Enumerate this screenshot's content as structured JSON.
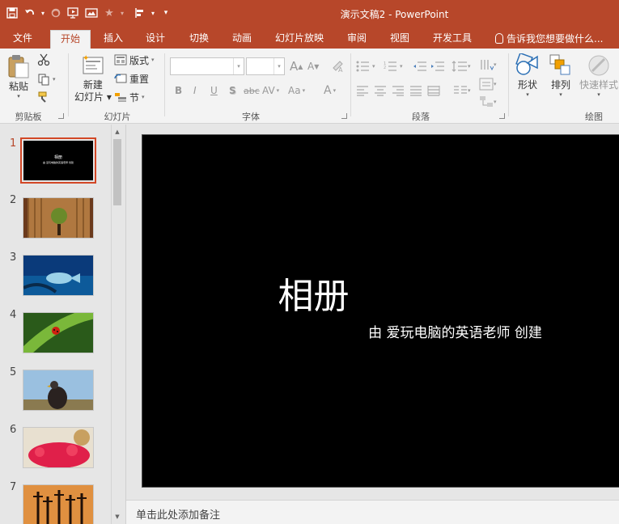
{
  "window": {
    "title": "演示文稿2 - PowerPoint"
  },
  "qat": {
    "save_icon": "save-icon",
    "undo_icon": "undo-icon",
    "redo_icon": "redo-icon",
    "present_icon": "from-beginning-icon",
    "caret": "▾"
  },
  "tabs": [
    {
      "label": "文件"
    },
    {
      "label": "开始"
    },
    {
      "label": "插入"
    },
    {
      "label": "设计"
    },
    {
      "label": "切换"
    },
    {
      "label": "动画"
    },
    {
      "label": "幻灯片放映"
    },
    {
      "label": "审阅"
    },
    {
      "label": "视图"
    },
    {
      "label": "开发工具"
    }
  ],
  "tell_me": "告诉我您想要做什么...",
  "ribbon": {
    "clipboard": {
      "paste": "粘贴",
      "label": "剪贴板"
    },
    "slides": {
      "new_slide_line1": "新建",
      "new_slide_line2": "幻灯片",
      "layout": "版式",
      "reset": "重置",
      "section": "节",
      "label": "幻灯片"
    },
    "font": {
      "label": "字体",
      "grow": "A",
      "shrink": "A",
      "bold": "B",
      "italic": "I",
      "underline": "U",
      "shadow": "S",
      "strike": "abc",
      "spacing": "AV",
      "case": "Aa",
      "color": "A"
    },
    "paragraph": {
      "label": "段落"
    },
    "drawing": {
      "shapes": "形状",
      "arrange": "排列",
      "quick_styles": "快速样式",
      "label": "绘图"
    }
  },
  "thumbnails": [
    {
      "num": "1",
      "selected": true,
      "title": "相册",
      "sub": "由 爱玩电脑的英语老师 创建"
    },
    {
      "num": "2",
      "selected": false
    },
    {
      "num": "3",
      "selected": false
    },
    {
      "num": "4",
      "selected": false
    },
    {
      "num": "5",
      "selected": false
    },
    {
      "num": "6",
      "selected": false
    },
    {
      "num": "7",
      "selected": false
    }
  ],
  "slide": {
    "title": "相册",
    "subtitle": "由 爱玩电脑的英语老师 创建"
  },
  "notes": {
    "placeholder": "单击此处添加备注"
  },
  "colors": {
    "accent": "#b7472a",
    "ribbon_bg": "#f3f3f3",
    "selection": "#d24726"
  }
}
